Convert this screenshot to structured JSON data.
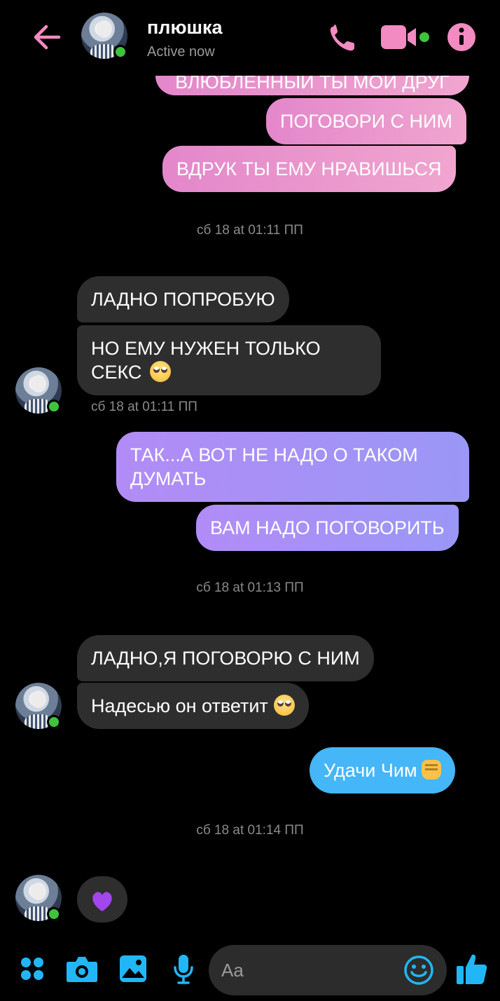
{
  "colors": {
    "accent_pink": "#f28bc1",
    "accent_blue": "#21b7f7",
    "online_green": "#3ec43a"
  },
  "header": {
    "name": "плюшка",
    "status": "Active now",
    "icons": [
      "back-arrow-icon",
      "phone-icon",
      "video-camera-icon",
      "info-icon"
    ]
  },
  "messages": {
    "partial_top": "ВЛЮБЛЕННЫЙ ТЫ МОЙ ДРУГ",
    "m1": "ПОГОВОРИ С НИМ",
    "m2": "ВДРУК ТЫ ЕМУ НРАВИШЬСЯ",
    "stamp1": "сб 18 at 01:11 ПП",
    "m3": "ЛАДНО ПОПРОБУЮ",
    "m4_line1": "НО ЕМУ НУЖЕН ТОЛЬКО",
    "m4_line2": "СЕКС",
    "stamp2": "сб 18 at 01:11 ПП",
    "m5_line1": "ТАК...А ВОТ НЕ НАДО О ТАКОМ",
    "m5_line2": "ДУМАТЬ",
    "m6": "ВАМ НАДО ПОГОВОРИТЬ",
    "stamp3": "сб 18 at 01:13 ПП",
    "m7": "ЛАДНО,Я ПОГОВОРЮ С НИМ",
    "m8": "Надесью он ответит",
    "m9": "Удачи Чим",
    "stamp4": "сб 18 at 01:14 ПП",
    "m10_emoji": "purple-heart-emoji"
  },
  "composer": {
    "placeholder": "Aa",
    "icons": [
      "apps-icon",
      "camera-icon",
      "gallery-icon",
      "microphone-icon",
      "emoji-icon",
      "thumbs-up-icon"
    ]
  }
}
